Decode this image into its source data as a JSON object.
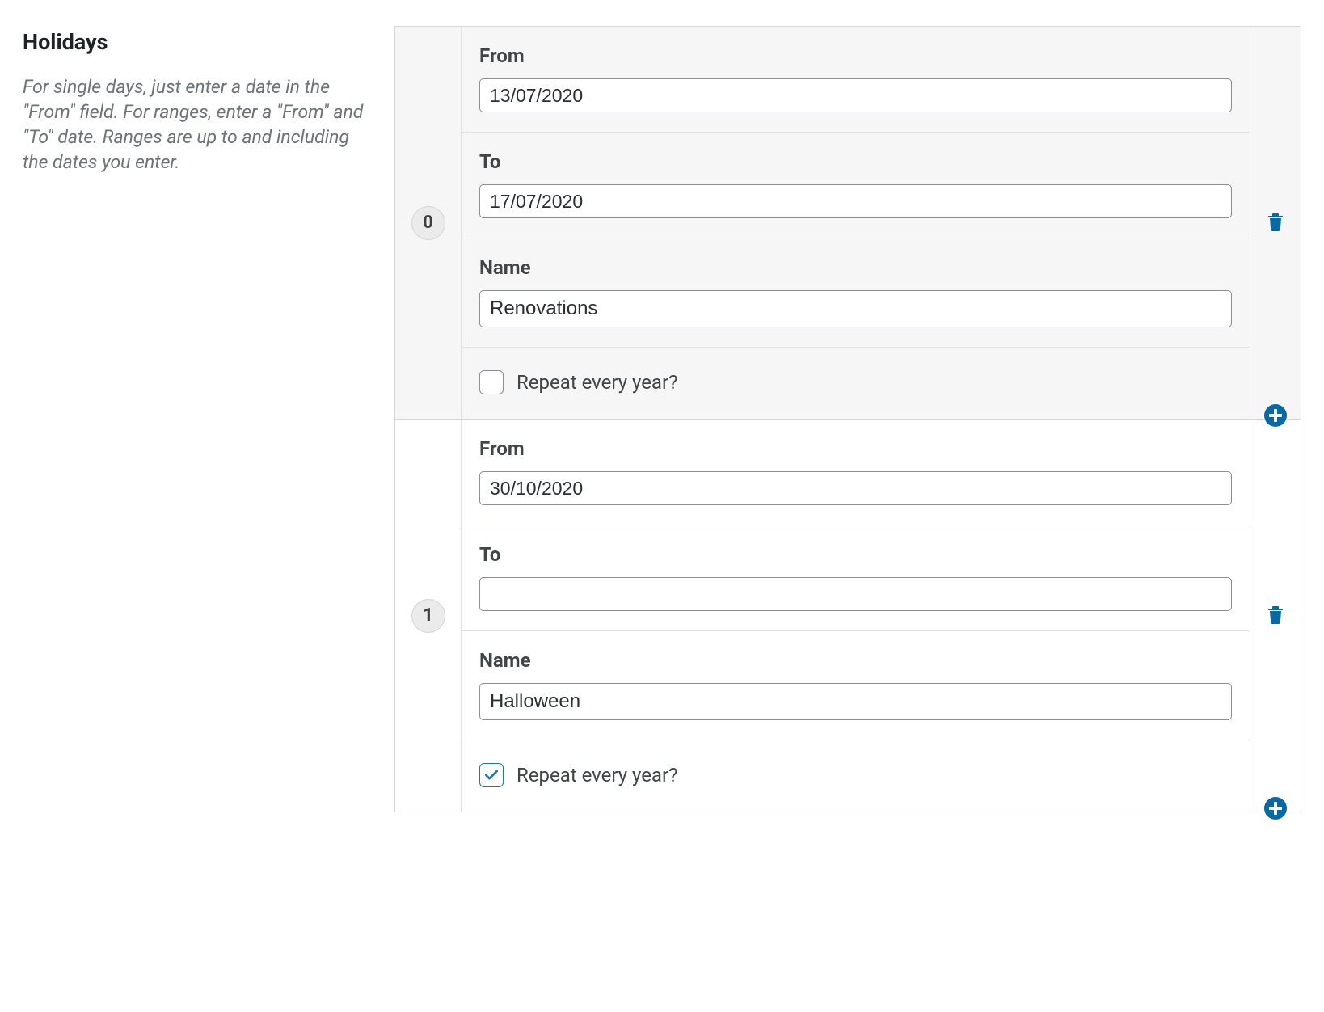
{
  "sidebar": {
    "title": "Holidays",
    "help": "For single days, just enter a date in the \"From\" field. For ranges, enter a \"From\" and \"To\" date. Ranges are up to and including the dates you enter."
  },
  "labels": {
    "from": "From",
    "to": "To",
    "name": "Name",
    "repeat": "Repeat every year?"
  },
  "rows": [
    {
      "index": "0",
      "from": "13/07/2020",
      "to": "17/07/2020",
      "name": "Renovations",
      "repeat": false
    },
    {
      "index": "1",
      "from": "30/10/2020",
      "to": "",
      "name": "Halloween",
      "repeat": true
    }
  ]
}
